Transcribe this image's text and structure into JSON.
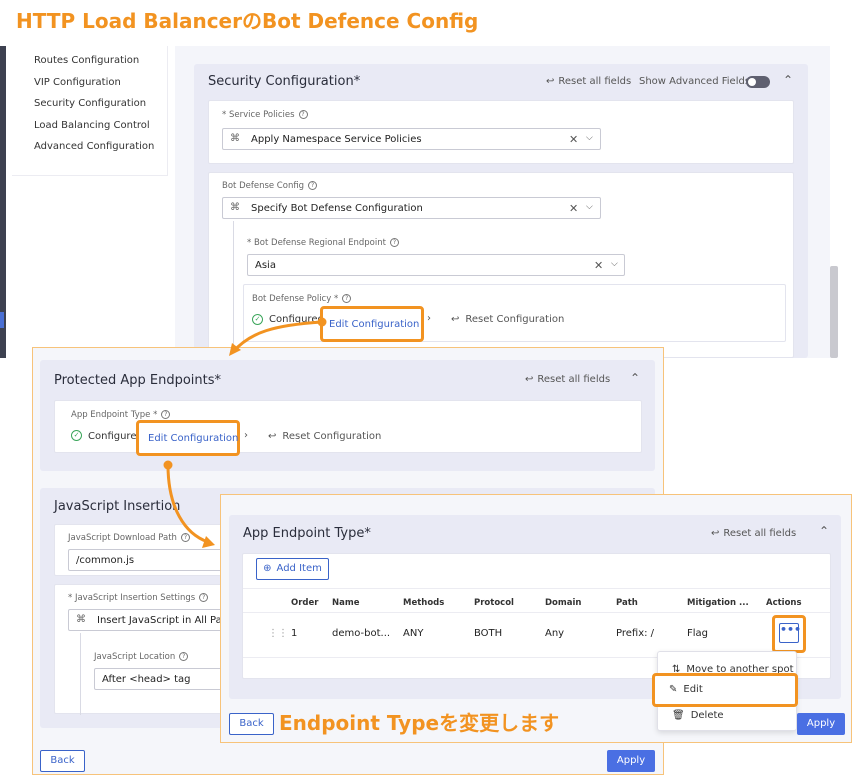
{
  "title": "HTTP Load BalancerのBot Defence Config",
  "colors": {
    "accent": "#f29321",
    "link": "#3a63c9",
    "primary": "#4a6fe3",
    "success": "#3aa55a"
  },
  "nav": {
    "items": [
      "Routes Configuration",
      "VIP Configuration",
      "Security Configuration",
      "Load Balancing Control",
      "Advanced Configuration"
    ]
  },
  "security": {
    "title": "Security Configuration",
    "required_mark": "*",
    "reset_label": "Reset all fields",
    "advanced_label": "Show Advanced Fields",
    "service_policies_label": "* Service Policies",
    "service_policies_value": "Apply Namespace Service Policies",
    "bot_config_label": "Bot Defense Config",
    "bot_config_value": "Specify Bot Defense Configuration",
    "endpoint_label": "* Bot Defense Regional Endpoint",
    "endpoint_value": "Asia",
    "policy_label": "Bot Defense Policy *",
    "configured_label": "Configured",
    "edit_label": "Edit Configuration",
    "reset_config_label": "Reset Configuration"
  },
  "protected": {
    "title": "Protected App Endpoints",
    "required_mark": "*",
    "reset_label": "Reset all fields",
    "type_label": "App Endpoint Type *",
    "configured_label": "Configured",
    "edit_label": "Edit Configuration",
    "reset_config_label": "Reset Configuration",
    "js_title": "JavaScript Insertion",
    "js_path_label": "JavaScript Download Path",
    "js_path_value": "/common.js",
    "js_settings_label": "* JavaScript Insertion Settings",
    "js_settings_value": "Insert JavaScript in All Pages",
    "js_location_label": "JavaScript Location",
    "js_location_value": "After <head> tag",
    "back_label": "Back",
    "apply_label": "Apply"
  },
  "endpoint_type": {
    "title": "App Endpoint Type",
    "required_mark": "*",
    "reset_label": "Reset all fields",
    "add_label": "Add Item",
    "columns": [
      "Order",
      "Name",
      "Methods",
      "Protocol",
      "Domain",
      "Path",
      "Mitigation ...",
      "Actions"
    ],
    "row": [
      "1",
      "demo-bot...",
      "ANY",
      "BOTH",
      "Any",
      "Prefix: /",
      "Flag"
    ],
    "menu_items": [
      "Move to another spot",
      "Edit",
      "Delete"
    ],
    "back_label": "Back",
    "apply_label": "Apply",
    "caption": "Endpoint Typeを変更します"
  }
}
